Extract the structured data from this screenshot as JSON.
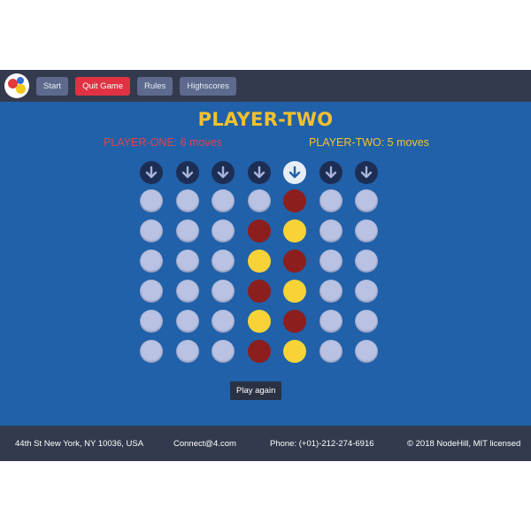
{
  "nav": {
    "buttons": [
      {
        "label": "Start",
        "variant": "default"
      },
      {
        "label": "Quit Game",
        "variant": "danger"
      },
      {
        "label": "Rules",
        "variant": "default"
      },
      {
        "label": "Highscores",
        "variant": "default"
      }
    ],
    "logo_icon": "connect-four-logo-icon"
  },
  "game": {
    "current_player": "PLAYER-TWO",
    "player_one_moves": "PLAYER-ONE: 6 moves",
    "player_two_moves": "PLAYER-TWO: 5 moves",
    "columns": 7,
    "rows": 6,
    "active_drop_column": 4,
    "grid": [
      [
        "empty",
        "empty",
        "empty",
        "empty",
        "red",
        "empty",
        "empty"
      ],
      [
        "empty",
        "empty",
        "empty",
        "red",
        "yellow",
        "empty",
        "empty"
      ],
      [
        "empty",
        "empty",
        "empty",
        "yellow",
        "red",
        "empty",
        "empty"
      ],
      [
        "empty",
        "empty",
        "empty",
        "red",
        "yellow",
        "empty",
        "empty"
      ],
      [
        "empty",
        "empty",
        "empty",
        "yellow",
        "red",
        "empty",
        "empty"
      ],
      [
        "empty",
        "empty",
        "empty",
        "red",
        "yellow",
        "empty",
        "empty"
      ]
    ],
    "play_again_label": "Play again",
    "colors": {
      "background": "#2061a9",
      "player_one": "#8d1e1e",
      "player_two": "#f7d338",
      "empty": "#b9c2e2"
    }
  },
  "footer": {
    "address": "44th St New York, NY 10036, USA",
    "email": "Connect@4.com",
    "phone": "Phone: (+01)-212-274-6916",
    "copyright": "© 2018 NodeHill, MIT licensed"
  }
}
